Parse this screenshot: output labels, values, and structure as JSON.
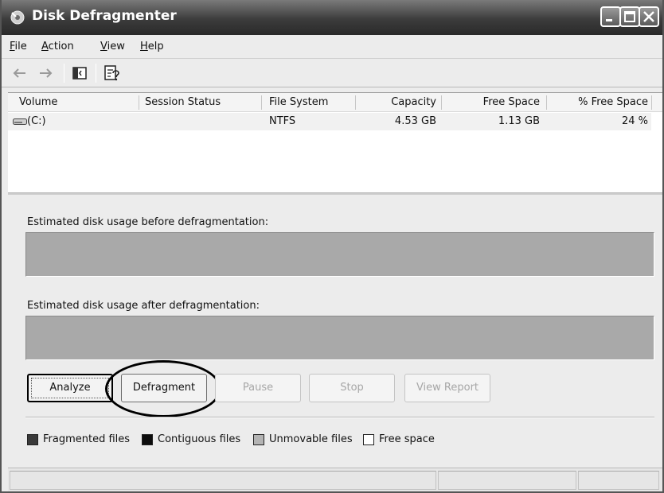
{
  "window": {
    "title": "Disk Defragmenter",
    "icons": {
      "app": "disk-defragmenter-icon",
      "minimize": "minimize-icon",
      "maximize": "maximize-icon",
      "close": "close-icon"
    }
  },
  "menu": {
    "file": {
      "u": "F",
      "rest": "ile"
    },
    "action": {
      "u": "A",
      "rest": "ction"
    },
    "view": {
      "u": "V",
      "rest": "iew"
    },
    "help": {
      "u": "H",
      "rest": "elp"
    }
  },
  "toolbar": {
    "icons": [
      "back-arrow-icon",
      "forward-arrow-icon",
      "show-hide-console-tree-icon",
      "properties-icon"
    ]
  },
  "volumes": {
    "headers": {
      "volume": "Volume",
      "session_status": "Session Status",
      "file_system": "File System",
      "capacity": "Capacity",
      "free_space": "Free Space",
      "pct_free": "% Free Space"
    },
    "rows": [
      {
        "volume": "(C:)",
        "session_status": "",
        "file_system": "NTFS",
        "capacity": "4.53 GB",
        "free_space": "1.13 GB",
        "pct_free": "24 %"
      }
    ]
  },
  "usage": {
    "before_label": "Estimated disk usage before defragmentation:",
    "after_label": "Estimated disk usage after defragmentation:",
    "bar_color": "#a9a9a9"
  },
  "buttons": {
    "analyze": "Analyze",
    "defragment": "Defragment",
    "pause": "Pause",
    "stop": "Stop",
    "view_report": "View Report"
  },
  "legend": [
    {
      "label": "Fragmented files",
      "color": "#3a3a3a"
    },
    {
      "label": "Contiguous files",
      "color": "#0d0d0d"
    },
    {
      "label": "Unmovable files",
      "color": "#b4b4b4"
    },
    {
      "label": "Free space",
      "color": "#ffffff"
    }
  ]
}
